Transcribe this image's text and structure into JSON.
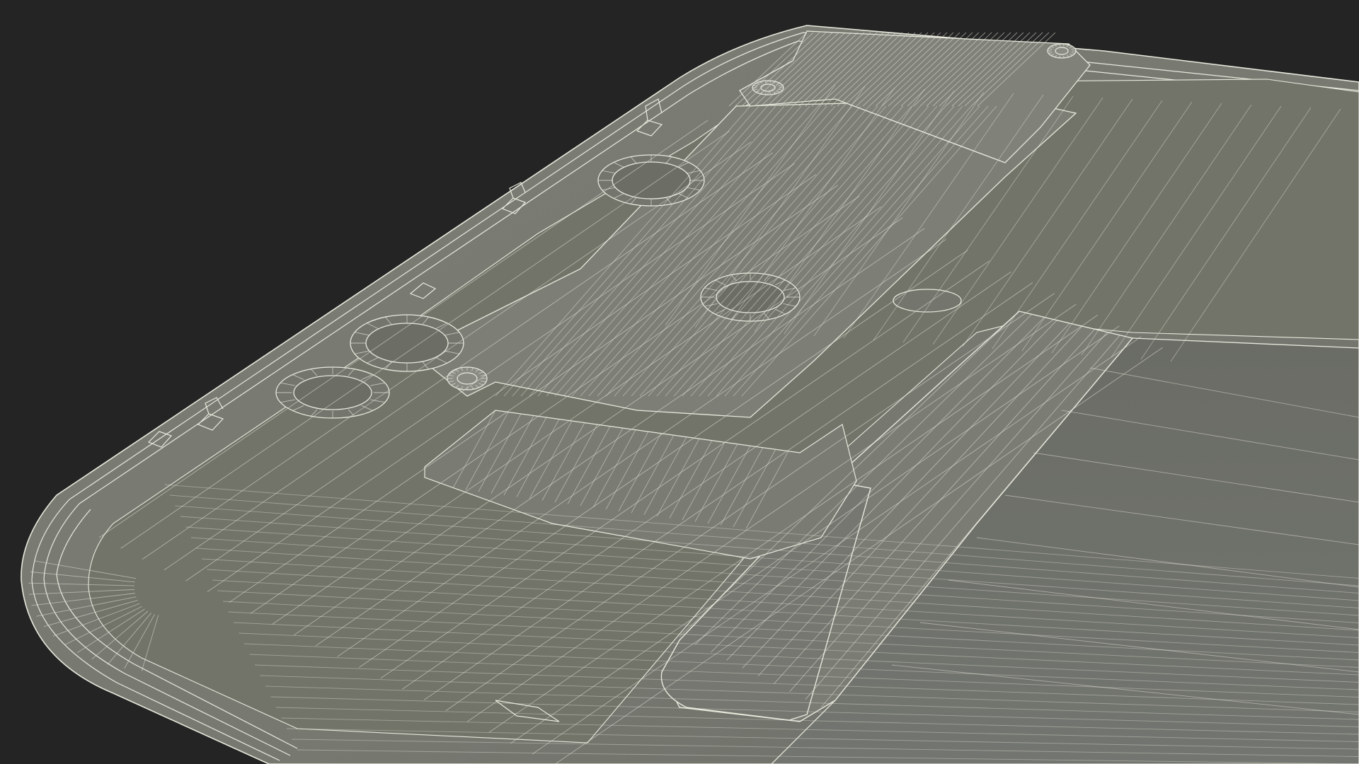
{
  "scene": {
    "background_color": "#242424",
    "surface_color": "#787a72",
    "surface_shade_color": "#6e7068",
    "wire_color": "#e8e8dc",
    "wire_dim_color": "#cfd0c4",
    "subject": "wireframe-3d-render"
  }
}
